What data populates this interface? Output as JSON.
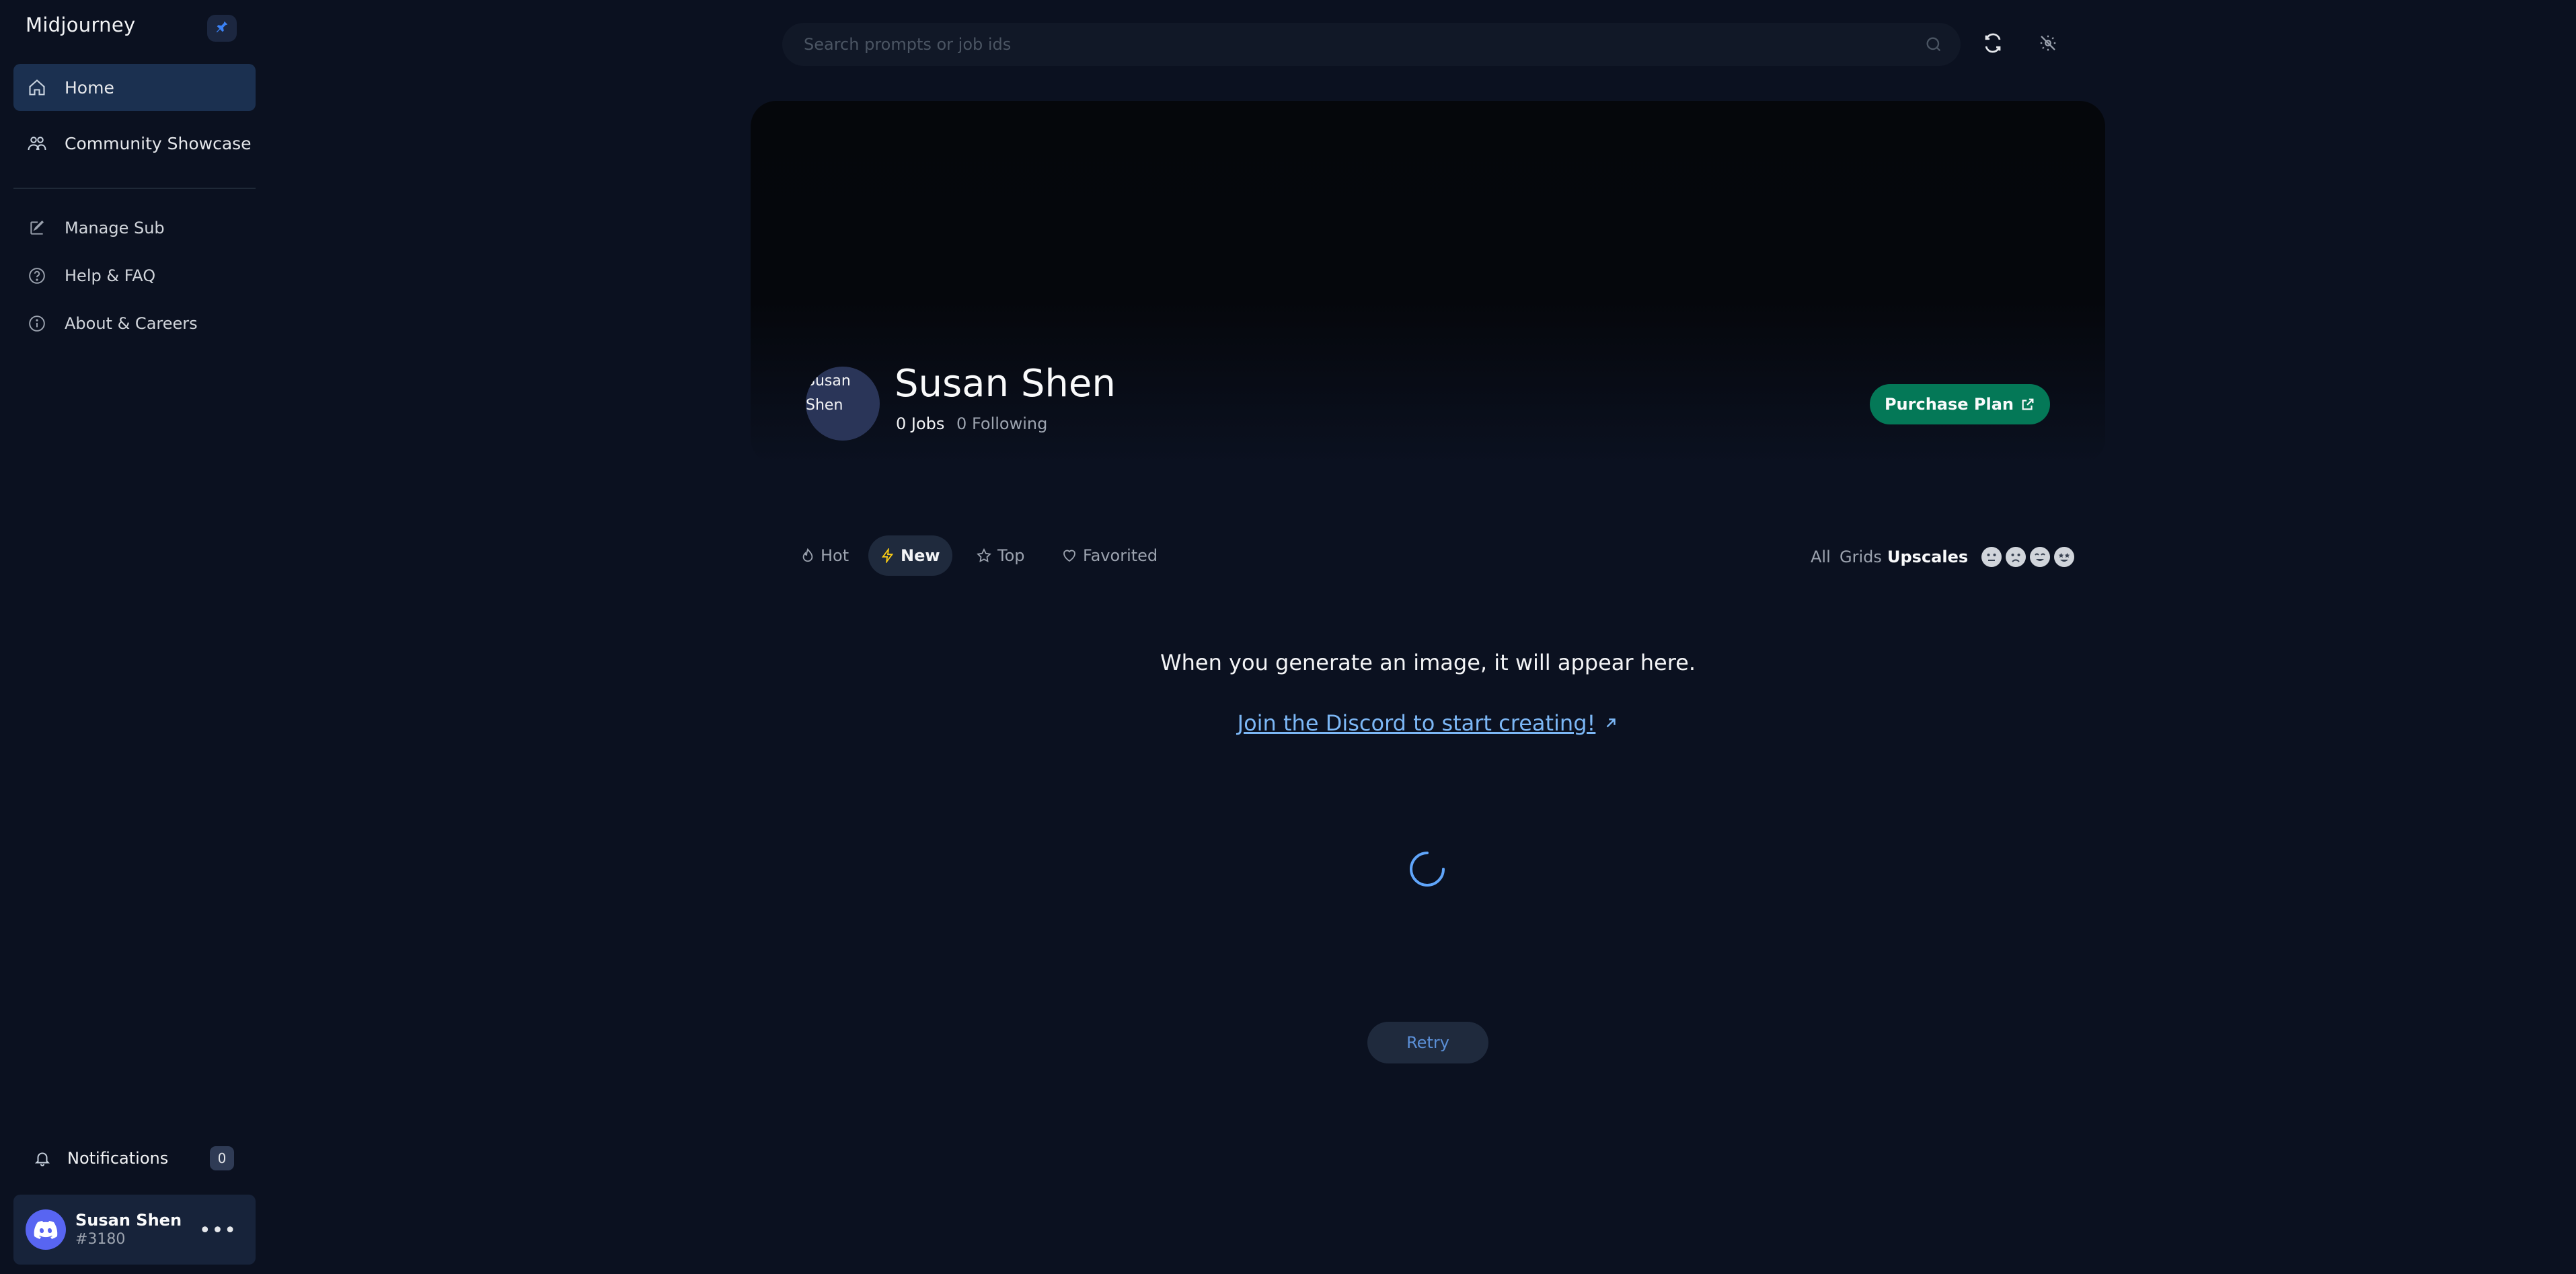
{
  "sidebar": {
    "brand": "Midjourney",
    "pin_icon": "pin-icon",
    "nav": [
      {
        "label": "Home",
        "icon": "home-icon",
        "active": true
      },
      {
        "label": "Community Showcase",
        "icon": "community-icon",
        "active": false
      }
    ],
    "secondary_nav": [
      {
        "label": "Manage Sub",
        "icon": "edit-icon"
      },
      {
        "label": "Help & FAQ",
        "icon": "help-icon"
      },
      {
        "label": "About & Careers",
        "icon": "info-icon"
      }
    ],
    "notifications": {
      "label": "Notifications",
      "count": "0"
    },
    "user": {
      "name": "Susan Shen",
      "tag": "#3180"
    }
  },
  "topbar": {
    "search_placeholder": "Search prompts or job ids",
    "icons": [
      "search-icon",
      "refresh-icon",
      "theme-toggle-icon"
    ]
  },
  "profile": {
    "avatar_alt": "Susan Shen",
    "name": "Susan Shen",
    "jobs": "0 Jobs",
    "following": "0 Following",
    "purchase_label": "Purchase Plan"
  },
  "feed": {
    "tabs": [
      {
        "label": "Hot",
        "icon": "flame-icon",
        "active": false
      },
      {
        "label": "New",
        "icon": "lightning-icon",
        "active": true
      },
      {
        "label": "Top",
        "icon": "star-icon",
        "active": false
      },
      {
        "label": "Favorited",
        "icon": "heart-icon",
        "active": false
      }
    ],
    "filters": [
      {
        "label": "All",
        "active": false
      },
      {
        "label": "Grids",
        "active": false
      },
      {
        "label": "Upscales",
        "active": true
      }
    ],
    "rating_faces": [
      "neutral-face-icon",
      "sad-face-icon",
      "happy-face-icon",
      "star-eyes-face-icon"
    ]
  },
  "empty_state": {
    "message": "When you generate an image, it will appear here.",
    "link": "Join the Discord to start creating!",
    "retry_label": "Retry"
  },
  "colors": {
    "background": "#0b1120",
    "accent_green": "#047857",
    "active_nav": "#1b3050",
    "link": "#7cb7f5"
  }
}
